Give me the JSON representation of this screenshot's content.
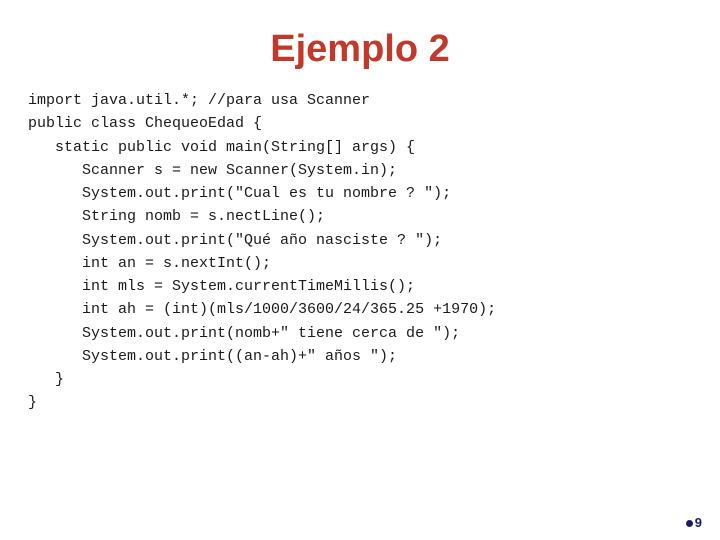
{
  "title": "Ejemplo 2",
  "code": {
    "lines": [
      "import java.util.*; //para usa Scanner",
      "public class ChequeoEdad {",
      "   static public void main(String[] args) {",
      "      Scanner s = new Scanner(System.in);",
      "      System.out.print(\"Cual es tu nombre ? \");",
      "      String nomb = s.nectLine();",
      "      System.out.print(\"Qué año nasciste ? \");",
      "      int an = s.nextInt();",
      "      int mls = System.currentTimeMillis();",
      "      int ah = (int)(mls/1000/3600/24/365.25 +1970);",
      "      System.out.print(nomb+\" tiene cerca de \");",
      "      System.out.print((an-ah)+\" años \");",
      "   }",
      "}"
    ]
  },
  "page_number": "9"
}
